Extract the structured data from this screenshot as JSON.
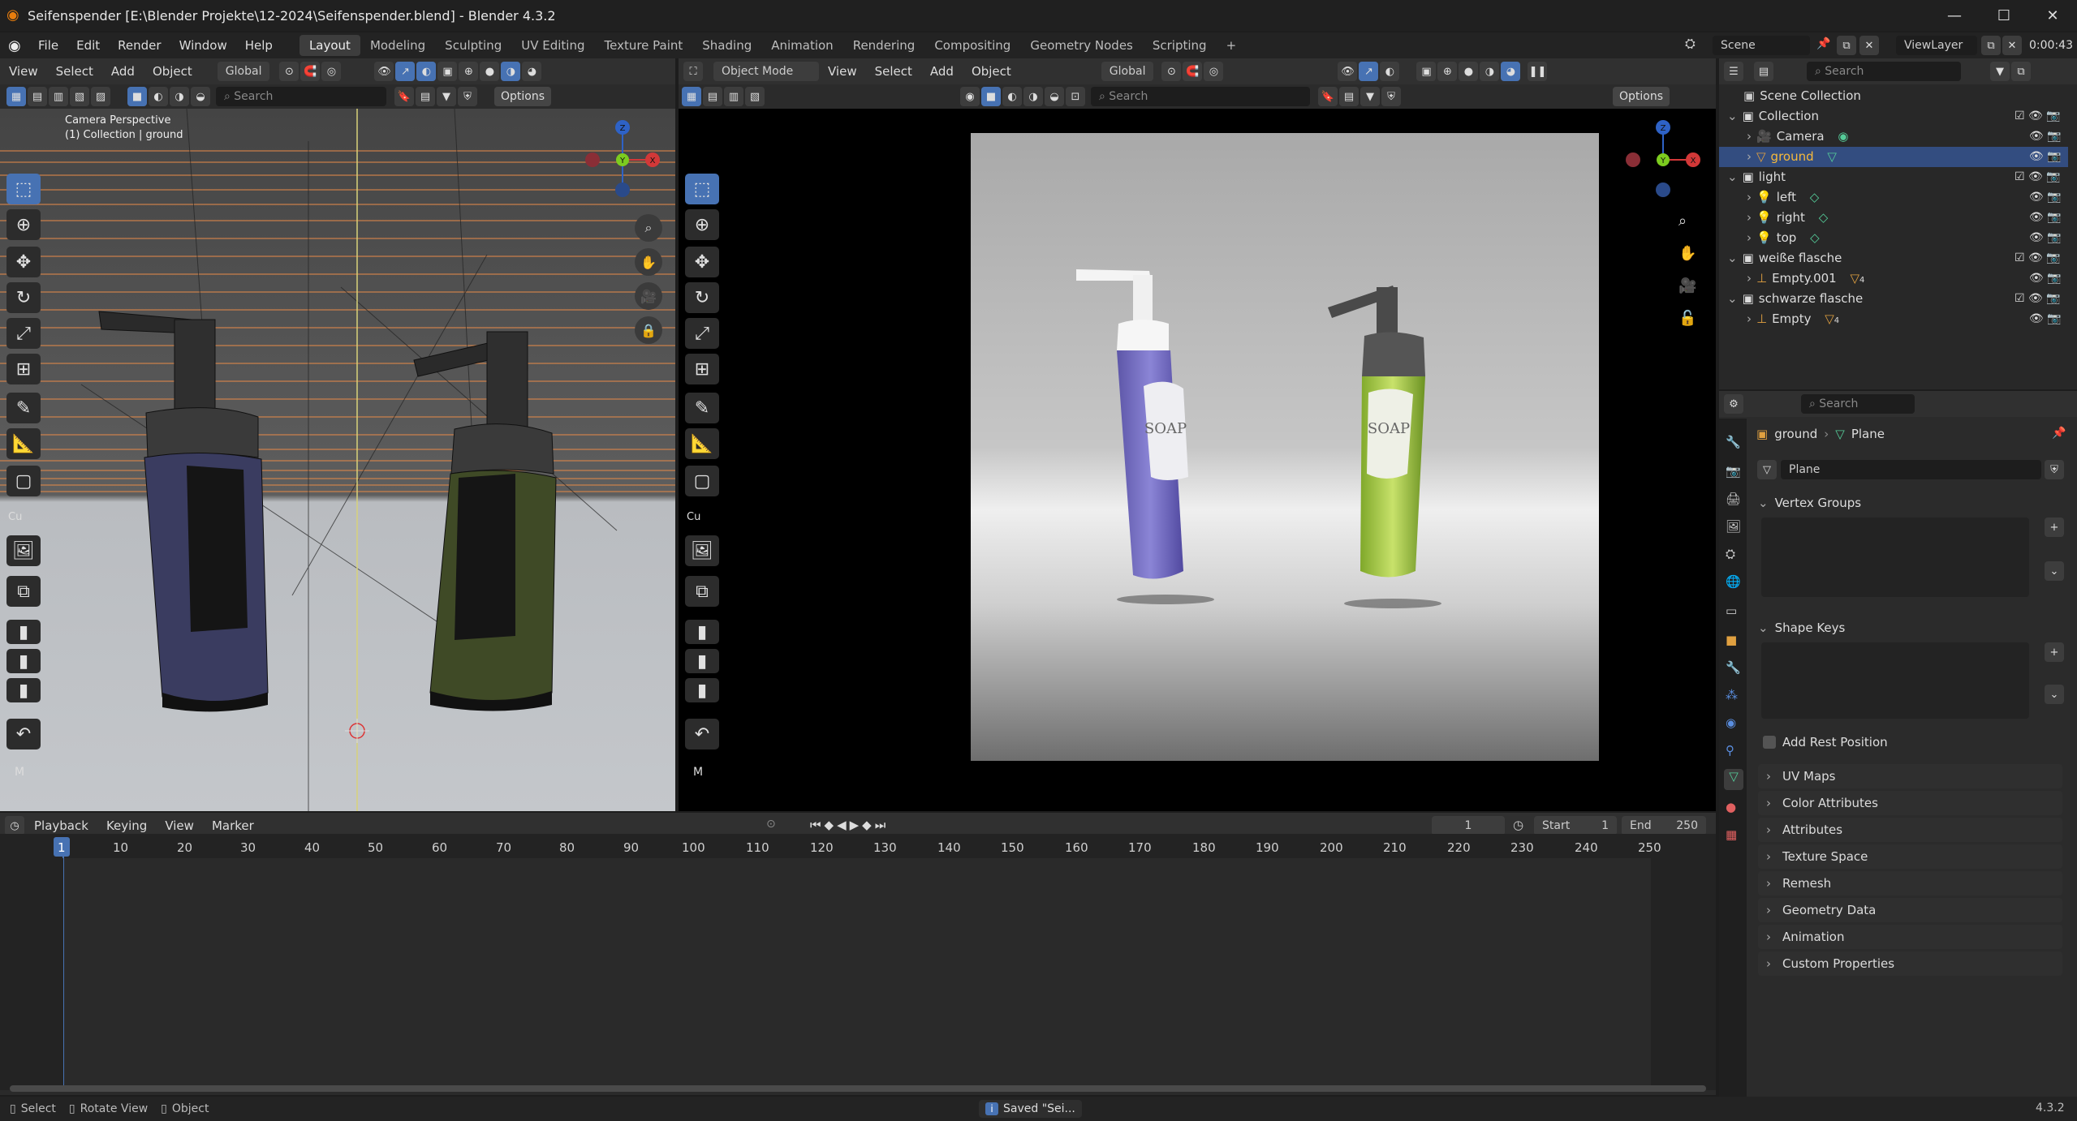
{
  "window": {
    "title": "Seifenspender [E:\\Blender Projekte\\12-2024\\Seifenspender.blend] - Blender 4.3.2"
  },
  "topbar": {
    "menus": [
      "File",
      "Edit",
      "Render",
      "Window",
      "Help"
    ],
    "workspaces": [
      "Layout",
      "Modeling",
      "Sculpting",
      "UV Editing",
      "Texture Paint",
      "Shading",
      "Animation",
      "Rendering",
      "Compositing",
      "Geometry Nodes",
      "Scripting"
    ],
    "active_workspace": "Layout",
    "add_tab": "+",
    "scene": "Scene",
    "view_layer": "ViewLayer",
    "time": "0:00:43"
  },
  "viewport_left": {
    "menus": [
      "View",
      "Select",
      "Add",
      "Object"
    ],
    "orientation": "Global",
    "search_placeholder": "Search",
    "options_label": "Options",
    "overlay_line1": "Camera Perspective",
    "overlay_line2": "(1) Collection | ground",
    "sidebar_tab": "Cu",
    "mode_letter": "M",
    "accent": "#4772b3"
  },
  "viewport_right": {
    "mode": "Object Mode",
    "menus": [
      "View",
      "Select",
      "Add",
      "Object"
    ],
    "orientation": "Global",
    "search_placeholder": "Search",
    "options_label": "Options",
    "sidebar_tab": "Cu",
    "mode_letter": "M",
    "label_text": "SOAP"
  },
  "outliner": {
    "search_placeholder": "Search",
    "root": "Scene Collection",
    "rows": [
      {
        "label": "Collection",
        "type": "collection"
      },
      {
        "label": "Camera",
        "type": "camera"
      },
      {
        "label": "ground",
        "type": "mesh",
        "selected": true
      },
      {
        "label": "light",
        "type": "collection"
      },
      {
        "label": "left",
        "type": "light"
      },
      {
        "label": "right",
        "type": "light"
      },
      {
        "label": "top",
        "type": "light"
      },
      {
        "label": "weiße flasche",
        "type": "collection"
      },
      {
        "label": "Empty.001",
        "type": "empty",
        "badge": "4"
      },
      {
        "label": "schwarze flasche",
        "type": "collection"
      },
      {
        "label": "Empty",
        "type": "empty",
        "badge": "4"
      }
    ]
  },
  "properties": {
    "search_placeholder": "Search",
    "breadcrumb_object": "ground",
    "breadcrumb_data": "Plane",
    "mesh_name": "Plane",
    "vertex_groups": "Vertex Groups",
    "shape_keys": "Shape Keys",
    "add_rest_position": "Add Rest Position",
    "panels": [
      "UV Maps",
      "Color Attributes",
      "Attributes",
      "Texture Space",
      "Remesh",
      "Geometry Data",
      "Animation",
      "Custom Properties"
    ]
  },
  "timeline": {
    "menus": [
      "Playback",
      "Keying",
      "View",
      "Marker"
    ],
    "current_frame": "1",
    "start_label": "Start",
    "start": "1",
    "end_label": "End",
    "end": "250",
    "ticks": [
      "1",
      "10",
      "20",
      "30",
      "40",
      "50",
      "60",
      "70",
      "80",
      "90",
      "100",
      "110",
      "120",
      "130",
      "140",
      "150",
      "160",
      "170",
      "180",
      "190",
      "200",
      "210",
      "220",
      "230",
      "240",
      "250"
    ]
  },
  "statusbar": {
    "select": "Select",
    "rotate": "Rotate View",
    "object": "Object",
    "message": "Saved \"Sei...",
    "version": "4.3.2"
  }
}
